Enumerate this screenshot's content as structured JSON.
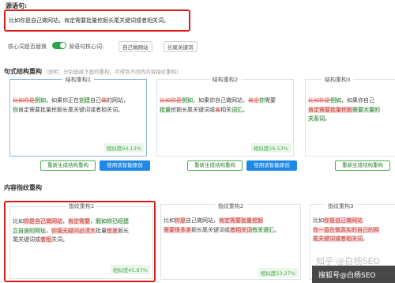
{
  "source": {
    "heading": "源语句:",
    "sentence": "比如你是自己做网站，肯定需要批量挖掘长尾关键词或者相关词。"
  },
  "keyword_row": {
    "replace_label": "核心词是否替换",
    "source_kw_label": "源语句核心词:",
    "tags": [
      "自己做网站",
      "长尾关键词"
    ]
  },
  "syntax_section": {
    "title": "句式结构重构",
    "hint": "(说明：分别选择下面的重构，可得到不同的内容指纹重构)",
    "cards": [
      {
        "header": "结构重构1",
        "similarity": "相似度64.13%",
        "regen_label": "重新生成结构重构",
        "use_label": "使用该智能原创"
      },
      {
        "header": "结构重构2",
        "similarity": "相似度56.53%",
        "regen_label": "重新生成结构重构",
        "use_label": "使用该智能原创"
      },
      {
        "header": "结构重构3",
        "similarity": "",
        "regen_label": "重新生成结构重构",
        "use_label": ""
      }
    ]
  },
  "fingerprint_section": {
    "title": "内容指纹重构",
    "cards": [
      {
        "header": "指纹重构1",
        "similarity": "相似度45.87%"
      },
      {
        "header": "指纹重构2",
        "similarity": "相似度53.27%"
      },
      {
        "header": "指纹重构3",
        "similarity": ""
      }
    ]
  },
  "watermark": {
    "zhihu": "知乎 @白杨SEO",
    "sohu": "搜狐号@白杨SEO"
  },
  "colors": {
    "highlight_red": "#d91e18",
    "toggle_green": "#2ea44f",
    "button_blue": "#1e88e5",
    "similarity_green": "#4caf50"
  }
}
